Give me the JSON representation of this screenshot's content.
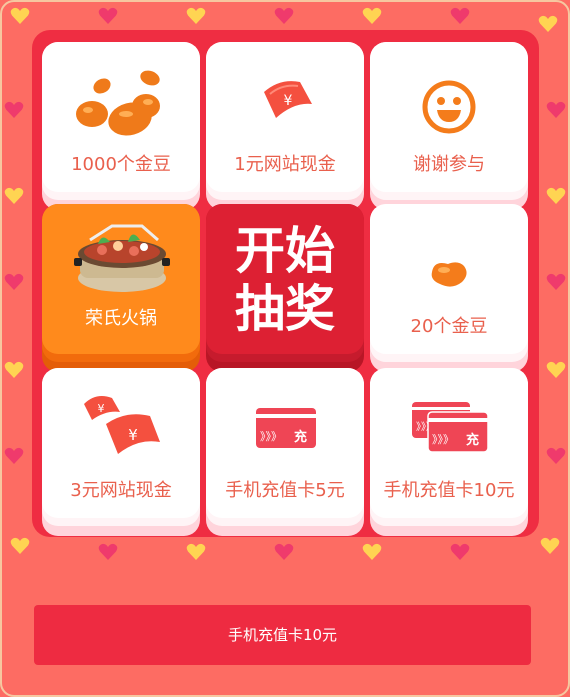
{
  "colors": {
    "background": "#fd6c63",
    "board": "#ef2d42",
    "cell": "#ffffff",
    "cell_label": "#e9604d",
    "selected_cell": "#ff8a1c",
    "start_cell": "#dd2033",
    "button": "#ee2b41",
    "heart_pink": "#ef3a6c",
    "heart_yellow": "#ffd452"
  },
  "grid": {
    "cells": [
      {
        "label": "1000个金豆",
        "icon": "beans-icon"
      },
      {
        "label": "1元网站现金",
        "icon": "cash-note-icon"
      },
      {
        "label": "谢谢参与",
        "icon": "smiley-icon"
      },
      {
        "label": "20个金豆",
        "icon": "bean-icon"
      },
      {
        "label": "手机充值卡10元",
        "icon": "recharge-cards-icon"
      },
      {
        "label": "手机充值卡5元",
        "icon": "recharge-card-icon"
      },
      {
        "label": "3元网站现金",
        "icon": "cash-notes-icon"
      },
      {
        "label": "荣氏火锅",
        "icon": "hotpot-icon",
        "selected": true
      }
    ],
    "start_button": {
      "line1": "开始",
      "line2": "抽奖"
    },
    "card_symbol": "充",
    "card_arrows": "》》》",
    "yen_symbol": "¥"
  },
  "result": {
    "label": "手机充值卡10元"
  }
}
